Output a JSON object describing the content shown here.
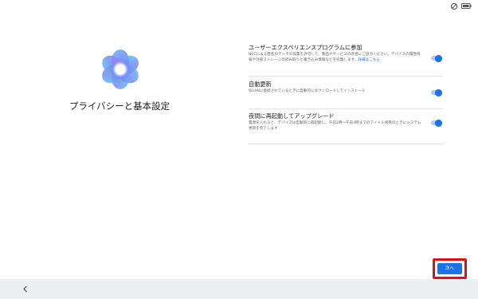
{
  "status_bar": {
    "icons": [
      "screen-rotation-icon",
      "battery-icon"
    ]
  },
  "setup": {
    "title": "プライバシーと基本設定",
    "logo_icon": "privacy-flower-logo-icon"
  },
  "settings": [
    {
      "title": "ユーザーエクスペリエンスプログラムに参加",
      "description": "NECによる匿名のデータの収集を許可して、製品やサービスの改善にご協力ください。デバイスの属性情報や外部ストレージの読み取りと書き込み情報などを収集します。",
      "link": "詳細はこちら",
      "enabled": true
    },
    {
      "title": "自動更新",
      "description": "WLANに接続されているときに自動的にダウンロードしてインストール",
      "enabled": true
    },
    {
      "title": "夜間に再起動してアップグレード",
      "description": "電源を入れると、デバイスは自動的に再起動し、午前2時〜午前4時までのアイドル状態のときにシステム更新を完了します",
      "enabled": true
    }
  ],
  "next_button": {
    "label": "次へ",
    "highlighted": true
  },
  "colors": {
    "accent": "#1a73e8",
    "toggle_track": "#aecbfa",
    "highlight_border": "#e0101a",
    "nav_bar": "#eceef0"
  },
  "nav_bar": {
    "back_icon": "back-chevron-icon"
  }
}
